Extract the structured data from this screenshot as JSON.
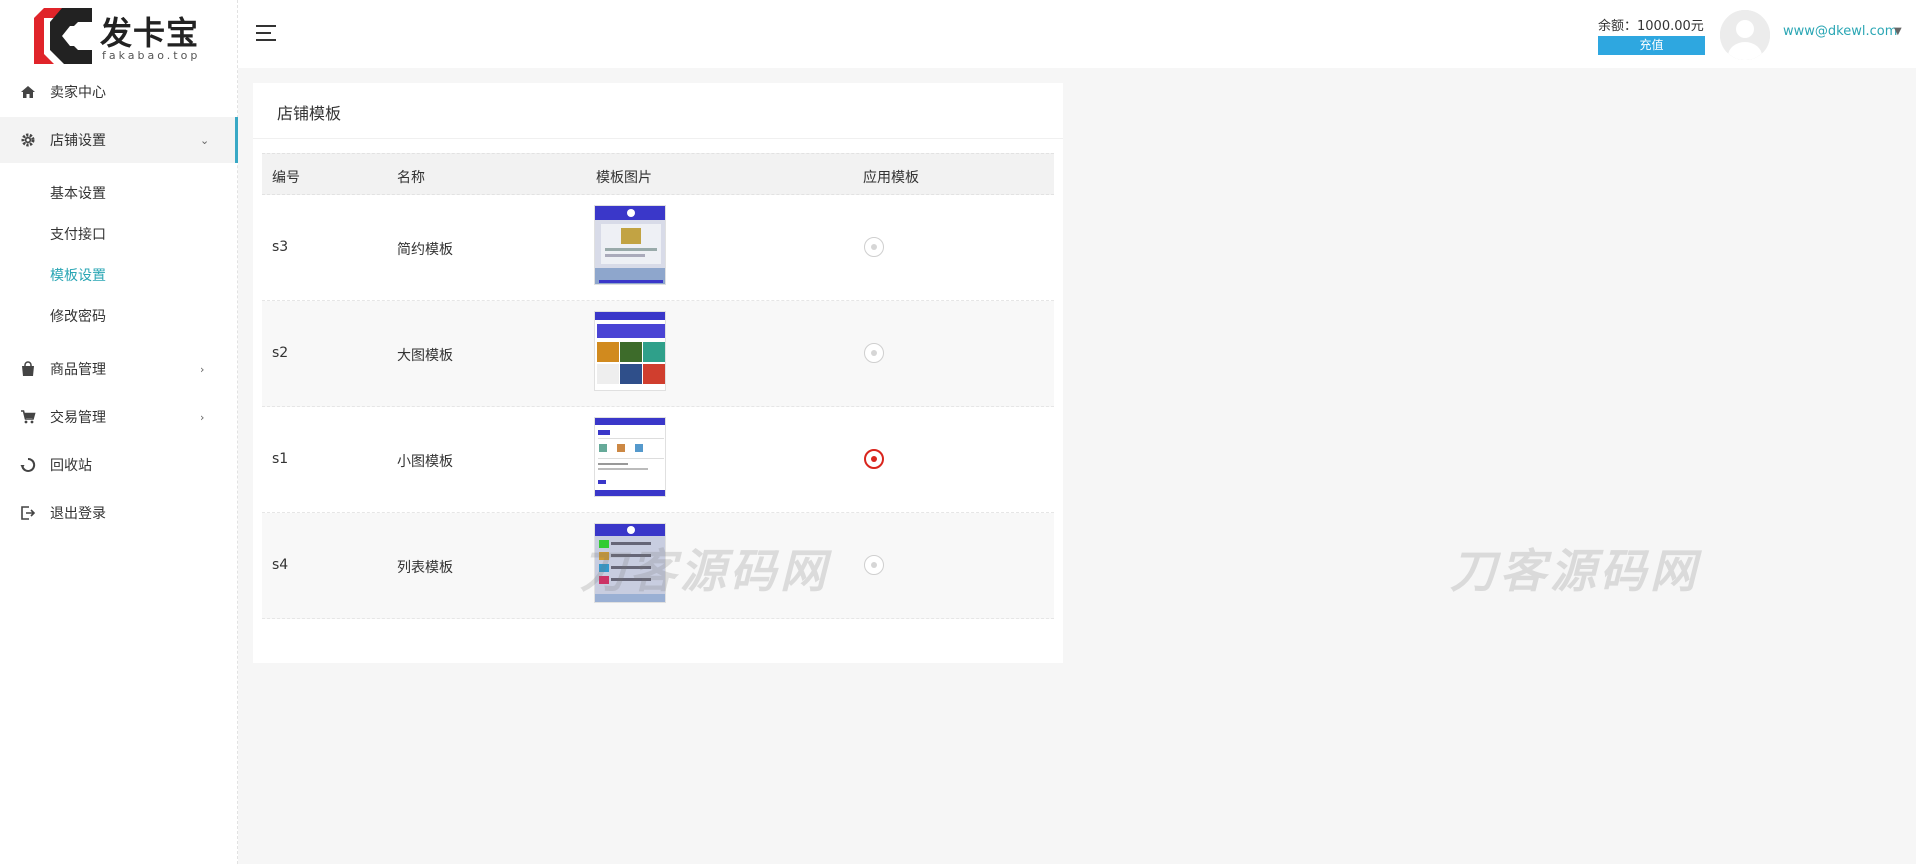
{
  "brand": {
    "name_cn": "发卡宝",
    "name_en": "fakabao.top"
  },
  "sidebar": {
    "items": [
      {
        "label": "卖家中心",
        "icon": "home-icon"
      },
      {
        "label": "店铺设置",
        "icon": "gear-icon"
      },
      {
        "label": "商品管理",
        "icon": "bag-icon"
      },
      {
        "label": "交易管理",
        "icon": "cart-icon"
      },
      {
        "label": "回收站",
        "icon": "recycle-icon"
      },
      {
        "label": "退出登录",
        "icon": "logout-icon"
      }
    ],
    "subitems": [
      "基本设置",
      "支付接口",
      "模板设置",
      "修改密码"
    ]
  },
  "header": {
    "balance": "余额：1000.00元",
    "recharge_label": "充值",
    "user_email": "www@dkewl.com"
  },
  "card": {
    "title": "店铺模板",
    "columns": [
      "编号",
      "名称",
      "模板图片",
      "应用模板"
    ],
    "rows": [
      {
        "id": "s3",
        "name": "简约模板",
        "selected": false
      },
      {
        "id": "s2",
        "name": "大图模板",
        "selected": false
      },
      {
        "id": "s1",
        "name": "小图模板",
        "selected": true
      },
      {
        "id": "s4",
        "name": "列表模板",
        "selected": false
      }
    ]
  },
  "watermark": "刀客源码网",
  "colors": {
    "accent": "#2aa6b4",
    "recharge": "#2ea7e0",
    "radio_selected": "#d9251d",
    "logo_red": "#e0242a"
  }
}
